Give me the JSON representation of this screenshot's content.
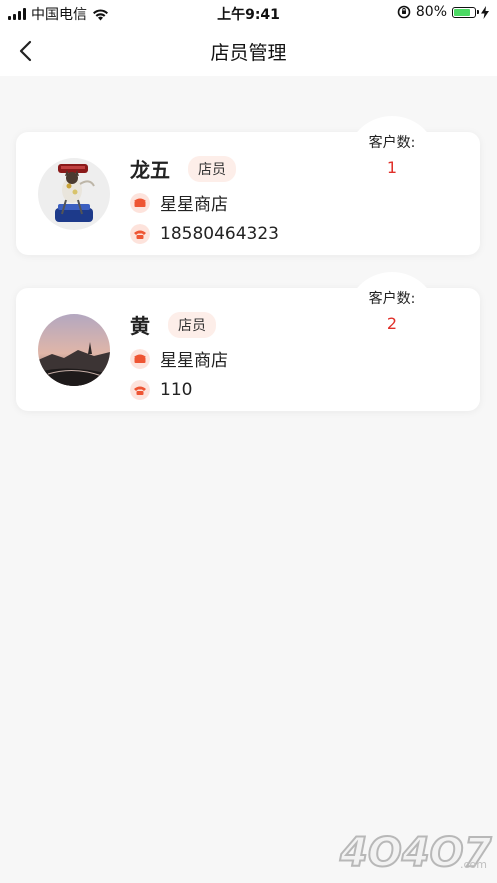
{
  "status_bar": {
    "carrier": "中国电信",
    "time": "上午9:41",
    "battery": "80%",
    "battery_level": 0.8
  },
  "nav": {
    "title": "店员管理"
  },
  "staff": [
    {
      "name": "龙五",
      "role": "店员",
      "store": "星星商店",
      "phone": "18580464323",
      "count_label": "客户数:",
      "count": "1"
    },
    {
      "name": "黄",
      "role": "店员",
      "store": "星星商店",
      "phone": "110",
      "count_label": "客户数:",
      "count": "2"
    }
  ],
  "watermark": "4O4O7.com",
  "colors": {
    "accent": "#e0302a",
    "badge_bg": "#fdeee9",
    "page_bg": "#f7f7f7"
  }
}
